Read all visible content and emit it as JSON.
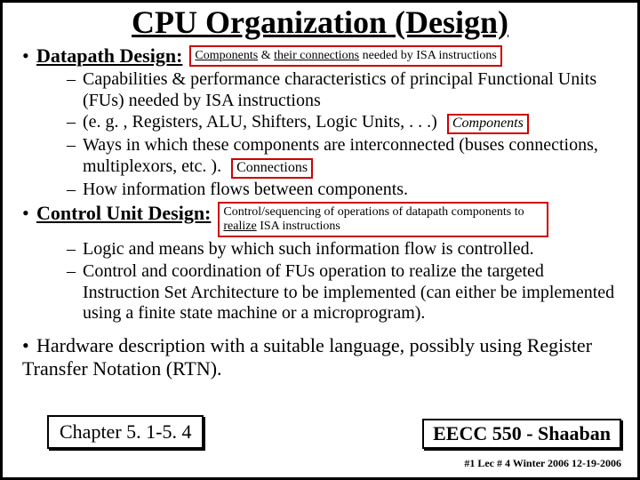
{
  "title": "CPU Organization (Design)",
  "datapath": {
    "heading": "Datapath Design:",
    "callout_html": "<span class='u'>Components</span> &amp; <span class='u'>their connections</span> needed by ISA instructions",
    "items": [
      "Capabilities & performance characteristics of principal Functional Units (FUs) needed by ISA instructions",
      "(e. g. , Registers, ALU, Shifters, Logic Units, . . .)",
      "Ways in which these components are interconnected (buses connections, multiplexors, etc. ).",
      "How information flows between components."
    ],
    "box_components": "Components",
    "box_connections": "Connections"
  },
  "control": {
    "heading": "Control Unit Design:",
    "callout_html": "Control/sequencing of operations of datapath components to <span class='u'>realize</span> ISA instructions",
    "items": [
      "Logic and means by which such information flow is controlled.",
      "Control and coordination of FUs operation to realize the targeted Instruction Set Architecture to be implemented (can either be implemented using a finite state machine or a microprogram)."
    ]
  },
  "hardware": "Hardware description with a suitable language, possibly using Register Transfer Notation (RTN).",
  "footer": {
    "chapter": "Chapter 5. 1-5. 4",
    "course": "EECC 550 - Shaaban",
    "meta": "#1   Lec # 4   Winter 2006   12-19-2006"
  }
}
